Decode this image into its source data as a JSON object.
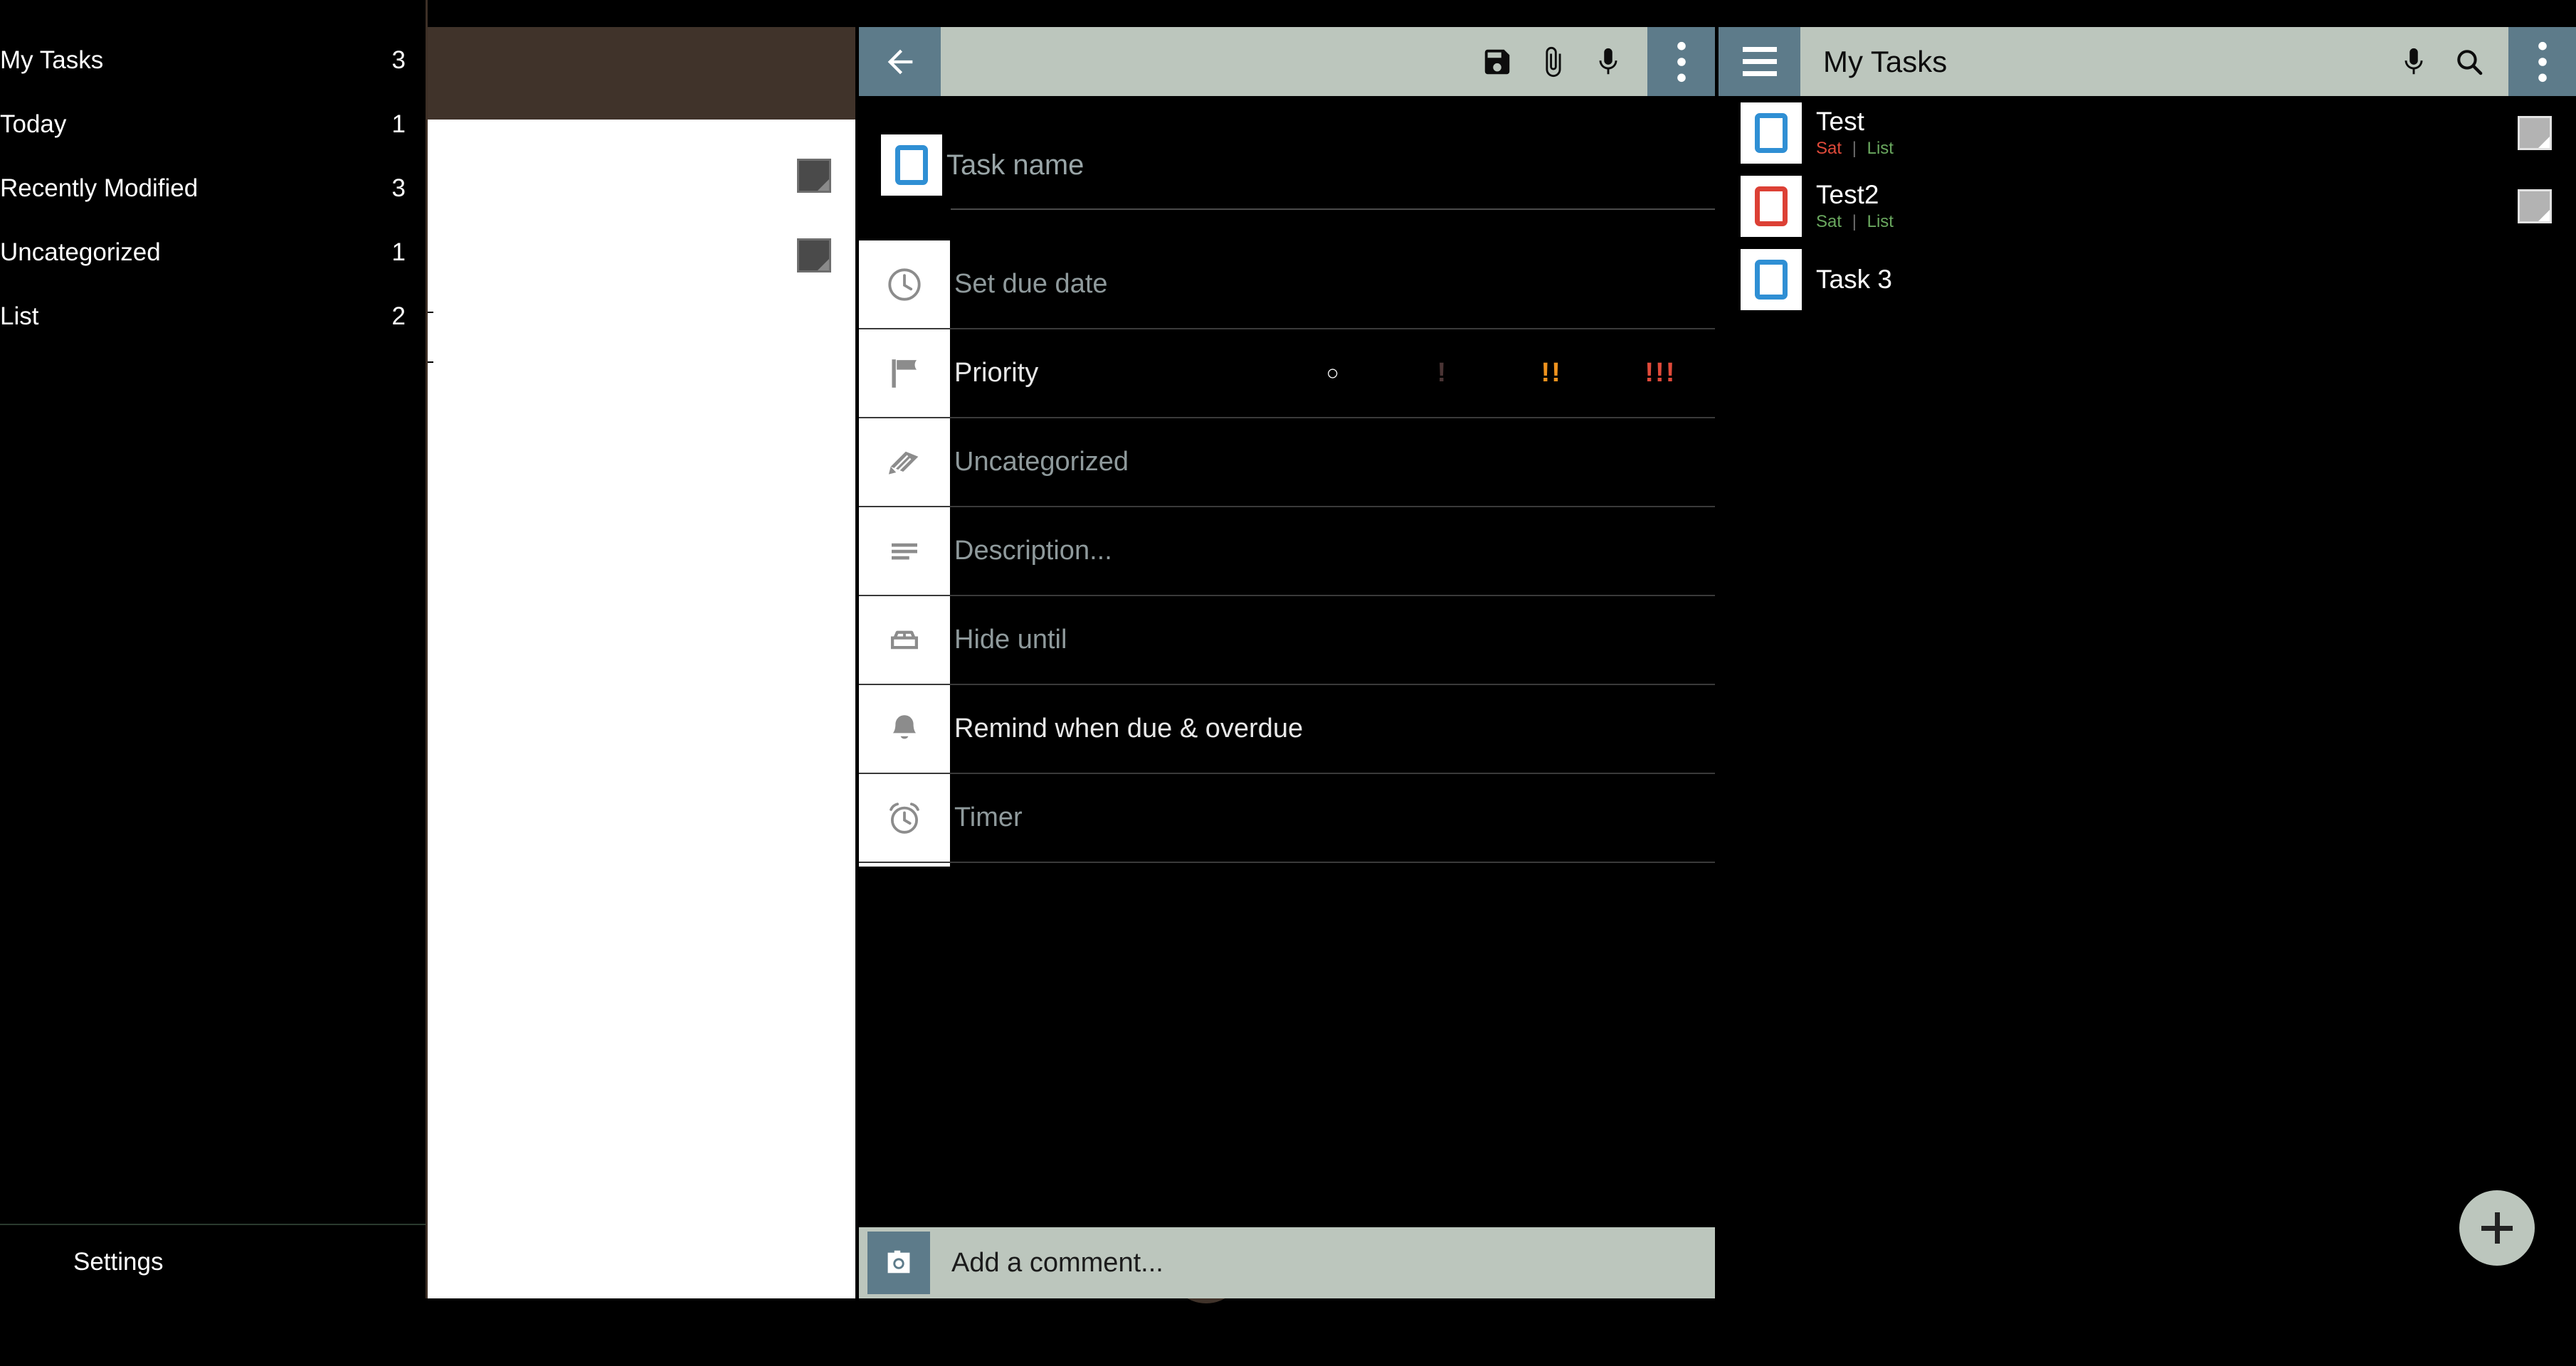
{
  "colors": {
    "toolbar_bg": "#bcc6bd",
    "toolbar_btn": "#5d7b8a",
    "brown_header": "#40332a",
    "checkbox_blue": "#2f8fd4",
    "checkbox_red": "#dc4035",
    "priority_high": "#e04a3a",
    "priority_medium": "#f0931e",
    "priority_low": "#3a2a2a",
    "overdue_red": "#e04a3a",
    "list_green": "#6aa85f",
    "panel_black": "#000000",
    "panel_white": "#ffffff"
  },
  "sidebar": {
    "items": [
      {
        "label": "My Tasks",
        "count": "3"
      },
      {
        "label": "Today",
        "count": "1"
      },
      {
        "label": "Recently Modified",
        "count": "3"
      },
      {
        "label": "Uncategorized",
        "count": "1"
      },
      {
        "label": "List",
        "count": "2"
      }
    ],
    "settings_label": "Settings"
  },
  "white_panel": {
    "fab_label": "+",
    "note_icons": [
      "note-icon",
      "note-icon"
    ]
  },
  "edit_panel": {
    "toolbar": {
      "back_icon": "back-arrow-icon",
      "save_icon": "save-floppy-icon",
      "attach_icon": "paperclip-icon",
      "mic_icon": "microphone-icon",
      "overflow_icon": "overflow-menu-icon"
    },
    "task_name": {
      "value": "",
      "placeholder": "Task name",
      "checkbox_state": "unchecked"
    },
    "fields": [
      {
        "icon": "clock-icon",
        "label": "Set due date",
        "style": "dim"
      },
      {
        "icon": "flag-icon",
        "label": "Priority",
        "style": "bright"
      },
      {
        "icon": "tag-icon",
        "label": "Uncategorized",
        "style": "dim"
      },
      {
        "icon": "description-lines-icon",
        "label": "Description...",
        "style": "dim"
      },
      {
        "icon": "bed-icon",
        "label": "Hide until",
        "style": "dim"
      },
      {
        "icon": "bell-icon",
        "label": "Remind when due & overdue",
        "style": "bright"
      },
      {
        "icon": "alarm-clock-icon",
        "label": "Timer",
        "style": "dim"
      }
    ],
    "priority_options": [
      {
        "marker": "○",
        "name": "none",
        "color": "#ffffff"
      },
      {
        "marker": "!",
        "name": "low",
        "color": "#3a2a2a"
      },
      {
        "marker": "!!",
        "name": "medium",
        "color": "#f0931e"
      },
      {
        "marker": "!!!",
        "name": "high",
        "color": "#e04a3a"
      }
    ],
    "comment": {
      "camera_icon": "camera-icon",
      "placeholder": "Add a comment..."
    }
  },
  "list_panel": {
    "toolbar": {
      "menu_icon": "hamburger-menu-icon",
      "title": "My Tasks",
      "mic_icon": "microphone-icon",
      "search_icon": "search-icon",
      "overflow_icon": "overflow-menu-icon"
    },
    "tasks": [
      {
        "title": "Test",
        "checkbox_color": "#2f8fd4",
        "due": "Sat",
        "due_color": "#e04a3a",
        "list": "List",
        "list_color": "#6aa85f",
        "separator": "|",
        "has_note": true
      },
      {
        "title": "Test2",
        "checkbox_color": "#dc4035",
        "due": "Sat",
        "due_color": "#6aa85f",
        "list": "List",
        "list_color": "#6aa85f",
        "separator": "|",
        "has_note": true
      },
      {
        "title": "Task 3",
        "checkbox_color": "#2f8fd4",
        "due": "",
        "due_color": "",
        "list": "",
        "list_color": "",
        "separator": "",
        "has_note": false
      }
    ],
    "fab_label": "+"
  }
}
